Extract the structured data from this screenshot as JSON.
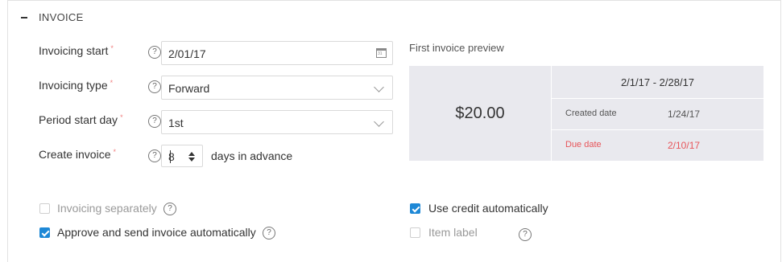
{
  "section": {
    "title": "INVOICE"
  },
  "fields": {
    "invoicing_start": {
      "label": "Invoicing start",
      "value": "2/01/17",
      "required_mark": "*"
    },
    "invoicing_type": {
      "label": "Invoicing type",
      "value": "Forward",
      "required_mark": "*"
    },
    "period_start_day": {
      "label": "Period start day",
      "value": "1st",
      "required_mark": "*"
    },
    "create_invoice": {
      "label": "Create invoice",
      "value": "8",
      "suffix": "days in advance",
      "required_mark": "*"
    }
  },
  "help_glyph": "?",
  "calendar_glyph": "31",
  "preview": {
    "title": "First invoice preview",
    "amount": "$20.00",
    "period": "2/1/17 - 2/28/17",
    "created_label": "Created date",
    "created_value": "1/24/17",
    "due_label": "Due date",
    "due_value": "2/10/17"
  },
  "options": {
    "invoicing_separately": {
      "label": "Invoicing separately",
      "checked": false,
      "disabled": true
    },
    "approve_send": {
      "label": "Approve and send invoice automatically",
      "checked": true,
      "disabled": false
    },
    "use_credit": {
      "label": "Use credit automatically",
      "checked": true,
      "disabled": false
    },
    "item_label": {
      "label": "Item label",
      "checked": false,
      "disabled": true
    }
  },
  "colors": {
    "accent": "#1e88d6",
    "due": "#e8555a",
    "required": "#f08080",
    "preview_bg": "#e9e9ee"
  }
}
